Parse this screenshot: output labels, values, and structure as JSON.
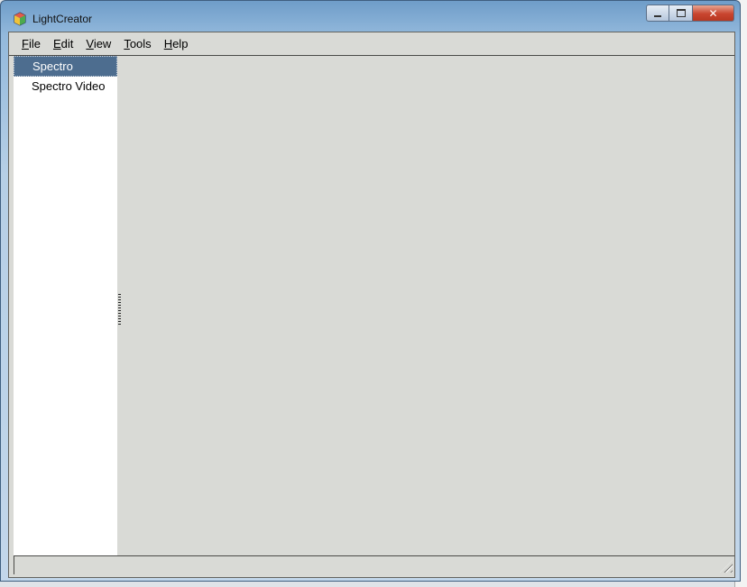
{
  "window": {
    "title": "LightCreator",
    "icon": "cube-app-icon",
    "controls": {
      "minimize": "minimize",
      "maximize": "maximize",
      "close": "close"
    }
  },
  "menubar": {
    "items": [
      {
        "hotkey": "F",
        "rest": "ile"
      },
      {
        "hotkey": "E",
        "rest": "dit"
      },
      {
        "hotkey": "V",
        "rest": "iew"
      },
      {
        "hotkey": "T",
        "rest": "ools"
      },
      {
        "hotkey": "H",
        "rest": "elp"
      }
    ]
  },
  "sidebar": {
    "items": [
      {
        "label": "Spectro",
        "selected": true
      },
      {
        "label": "Spectro Video",
        "selected": false
      }
    ]
  },
  "colors": {
    "selection": "#4d6d8f",
    "client_bg": "#d9dad6",
    "close_button": "#c8452f"
  }
}
